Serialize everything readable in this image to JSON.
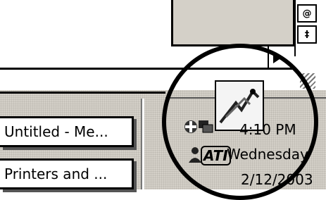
{
  "window": {
    "side_buttons": [
      "@",
      "‡"
    ],
    "scroll_icon": "scroll-right-arrow-icon"
  },
  "taskbar": {
    "buttons": [
      {
        "label": "Untitled - Me..."
      },
      {
        "label": "Printers and ..."
      }
    ]
  },
  "tray": {
    "icons": [
      "network-icon",
      "computer-icon",
      "user-icon",
      "ati-icon",
      "custom-app-icon"
    ],
    "ati_label": "ATI",
    "time": "4:10 PM",
    "day": "Wednesday",
    "date": "2/12/2003"
  },
  "colors": {
    "taskbar": "#d4d0c8",
    "highlight_circle": "#000000"
  }
}
